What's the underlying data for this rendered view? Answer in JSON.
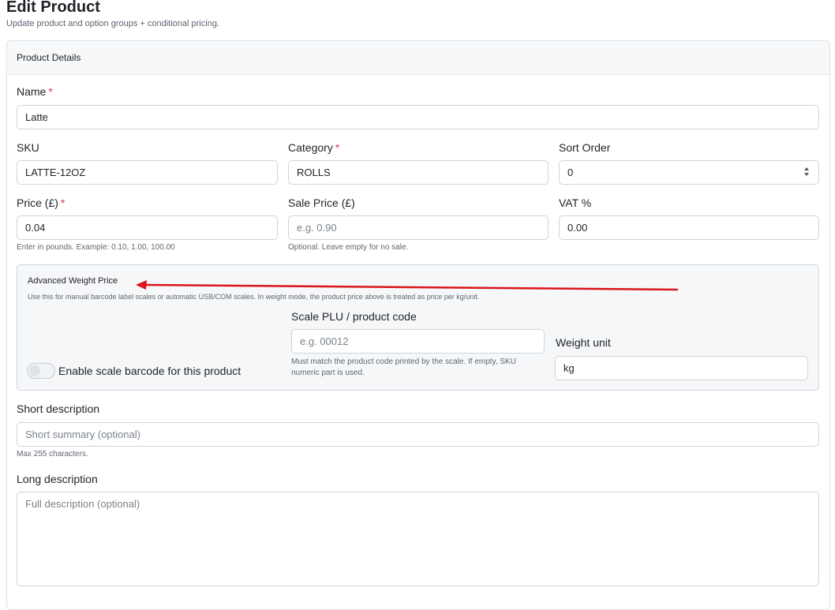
{
  "page": {
    "title": "Edit Product",
    "subtitle": "Update product and option groups + conditional pricing."
  },
  "card": {
    "header": "Product Details"
  },
  "fields": {
    "name": {
      "label": "Name",
      "required": "*",
      "value": "Latte"
    },
    "sku": {
      "label": "SKU",
      "value": "LATTE-12OZ"
    },
    "category": {
      "label": "Category",
      "required": "*",
      "value": "ROLLS"
    },
    "sort_order": {
      "label": "Sort Order",
      "value": "0"
    },
    "price": {
      "label": "Price (£)",
      "required": "*",
      "value": "0.04",
      "hint": "Enter in pounds. Example: 0.10, 1.00, 100.00"
    },
    "sale_price": {
      "label": "Sale Price (£)",
      "placeholder": "e.g. 0.90",
      "hint": "Optional. Leave empty for no sale."
    },
    "vat": {
      "label": "VAT %",
      "value": "0.00"
    }
  },
  "weight": {
    "title": "Advanced Weight Price",
    "description": "Use this for manual barcode label scales or automatic USB/COM scales. In weight mode, the product price above is treated as price per kg/unit.",
    "toggle_label": "Enable scale barcode for this product",
    "toggle_on": false,
    "plu": {
      "label": "Scale PLU / product code",
      "placeholder": "e.g. 00012",
      "hint_line1": "Must match the product code printed by the scale. If empty, SKU",
      "hint_line2": "numeric part is used."
    },
    "unit": {
      "label": "Weight unit",
      "value": "kg"
    }
  },
  "short_desc": {
    "label": "Short description",
    "placeholder": "Short summary (optional)",
    "hint": "Max 255 characters."
  },
  "long_desc": {
    "label": "Long description",
    "placeholder": "Full description (optional)"
  },
  "colors": {
    "required": "#dc3545",
    "annotation_arrow": "#d9161c"
  }
}
